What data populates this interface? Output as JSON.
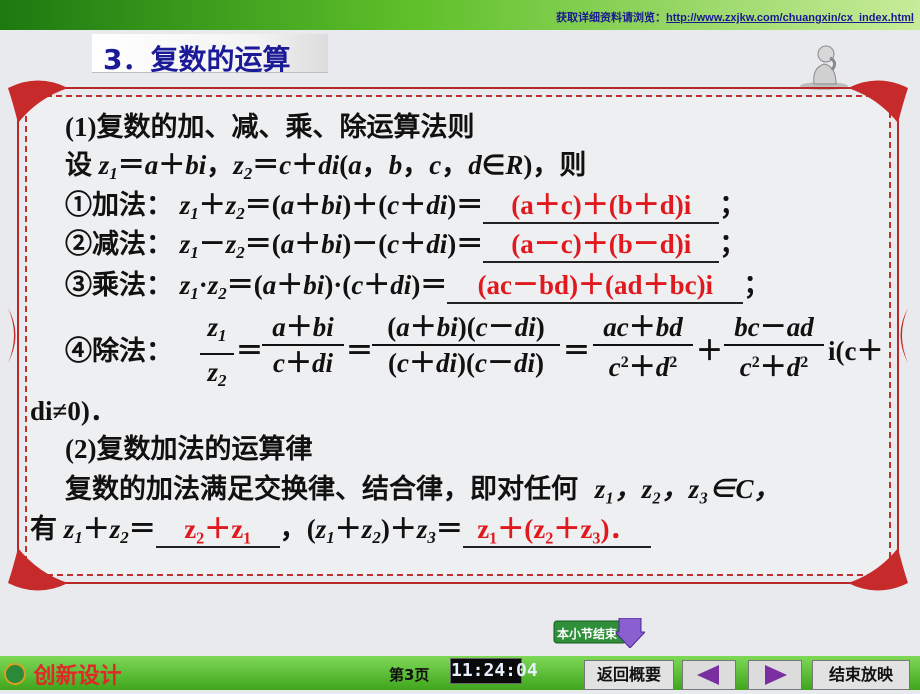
{
  "header": {
    "link_label": "获取详细资料请浏览：",
    "link_url": "http://www.zxjkw.com/chuangxin/cx_index.html"
  },
  "title": "3．复数的运算",
  "content": {
    "section1_heading": "(1)复数的加、减、乘、除运算法则",
    "define_prefix": "设",
    "define_tail": "，则",
    "add_label": "①加法：",
    "add_answer": "(a＋c)＋(b＋d)i",
    "sub_label": "②减法：",
    "sub_answer": "(a－c)＋(b－d)i",
    "mul_label": "③乘法：",
    "mul_answer": "(ac－bd)＋(ad＋bc)i",
    "div_label": "④除法：",
    "div_tail_1": "i(c＋",
    "div_tail_2": "di≠0)．",
    "section2_heading": "(2)复数加法的运算律",
    "law_text": "复数的加法满足交换律、结合律，即对任何",
    "law_set": "z₁，z₂，z₃∈C，",
    "law_prefix": "有",
    "law_answer_1": "z₂＋z₁",
    "law_answer_2": "z₁＋(z₂＋z₃)．"
  },
  "controls": {
    "end_section_button": "本小节结束",
    "page_number": "第3页",
    "clock": "11:24:04",
    "back_button": "返回概要",
    "end_show_button": "结束放映"
  },
  "logo_text": "创新设计"
}
